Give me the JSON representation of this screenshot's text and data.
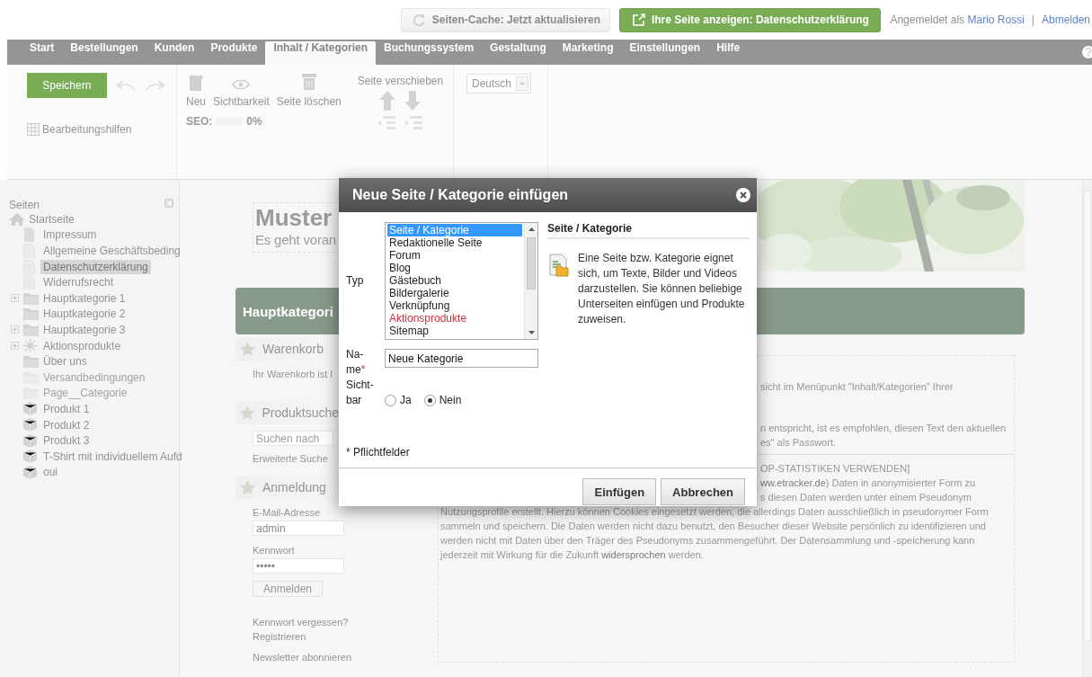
{
  "top_bar": {
    "cache_button": "Seiten-Cache: Jetzt aktualisieren",
    "view_button": "Ihre Seite anzeigen: Datenschutzerklärung",
    "logged_in_label": "Angemeldet als",
    "user": "Mario Rossi",
    "separator": "|",
    "logout": "Abmelden"
  },
  "nav_tabs": [
    {
      "label": "Start",
      "selected": false
    },
    {
      "label": "Bestellungen",
      "selected": false
    },
    {
      "label": "Kunden",
      "selected": false
    },
    {
      "label": "Produkte",
      "selected": false
    },
    {
      "label": "Inhalt / Kategorien",
      "selected": true
    },
    {
      "label": "Buchungssystem",
      "selected": false
    },
    {
      "label": "Gestaltung",
      "selected": false
    },
    {
      "label": "Marketing",
      "selected": false
    },
    {
      "label": "Einstellungen",
      "selected": false
    },
    {
      "label": "Hilfe",
      "selected": false
    }
  ],
  "ribbon": {
    "save": "Speichern",
    "editing_aids": "Bearbeitungshilfen",
    "actions": [
      {
        "label": "Neu",
        "kind": "new"
      },
      {
        "label": "Sichtbarkeit",
        "kind": "visibility"
      },
      {
        "label": "Seite löschen",
        "kind": "delete"
      }
    ],
    "seo_label": "SEO:",
    "seo": {
      "level": 0
    },
    "seo_reading": "0%",
    "move_label": "Seite verschieben",
    "language": "Deutsch"
  },
  "sidebar": {
    "title": "Seiten",
    "tree": [
      {
        "label": "Startseite",
        "kind": "home",
        "selected": false,
        "collapsed": false,
        "children": [
          {
            "label": "Impressum",
            "kind": "page",
            "selected": false,
            "collapsed": false
          },
          {
            "label": "Allgemeine Geschäftsbeding",
            "kind": "legal",
            "selected": false,
            "collapsed": false
          },
          {
            "label": "Datenschutzerklärung",
            "kind": "legal",
            "selected": true,
            "collapsed": false
          },
          {
            "label": "Widerrufsrecht",
            "kind": "legal",
            "selected": false,
            "collapsed": false
          },
          {
            "label": "Hauptkategorie 1",
            "kind": "folder",
            "selected": false,
            "collapsed": true
          },
          {
            "label": "Hauptkategorie 2",
            "kind": "folder",
            "selected": false,
            "collapsed": false
          },
          {
            "label": "Hauptkategorie 3",
            "kind": "folder",
            "selected": false,
            "collapsed": true
          },
          {
            "label": "Aktionsprodukte",
            "kind": "promo",
            "selected": false,
            "collapsed": true
          },
          {
            "label": "Über uns",
            "kind": "folder",
            "selected": false,
            "collapsed": false
          },
          {
            "label": "Versandbedingungen",
            "kind": "folder-hidden",
            "selected": false,
            "collapsed": false
          },
          {
            "label": "Page__Categorie",
            "kind": "folder-hidden",
            "selected": false,
            "collapsed": false
          },
          {
            "label": "Produkt 1",
            "kind": "product",
            "selected": false,
            "collapsed": false
          },
          {
            "label": "Produkt 2",
            "kind": "product",
            "selected": false,
            "collapsed": false
          },
          {
            "label": "Produkt 3",
            "kind": "product",
            "selected": false,
            "collapsed": false
          },
          {
            "label": "T-Shirt mit individuellem Aufd",
            "kind": "product",
            "selected": false,
            "collapsed": false
          },
          {
            "label": "oui",
            "kind": "product",
            "selected": false,
            "collapsed": false
          }
        ]
      }
    ]
  },
  "preview": {
    "logo": "Muster",
    "slogan": "Es geht voran",
    "heading": "Hauptkategori",
    "cart": {
      "title": "Warenkorb",
      "text": "Ihr Warenkorb ist l"
    },
    "search": {
      "title": "Produktsuche",
      "placeholder": "Suchen nach",
      "advanced": "Erweiterte Suche"
    },
    "login": {
      "title": "Anmeldung",
      "email_label": "E-Mail-Adresse",
      "email": "admin",
      "password_label": "Kennwort",
      "password": "•••••",
      "button": "Anmelden",
      "forgot": "Kennwort vergessen?",
      "register": "Registrieren",
      "newsletter": "Newsletter abonnieren"
    },
    "notice_lines": [
      {
        "text": "sicht im Menüpunkt \"Inhalt/Kategorien\" Ihrer"
      },
      {
        "text": "n entspricht, ist es empfohlen, diesen Text den aktuellen"
      },
      {
        "text": "es\" als Passwort."
      }
    ],
    "privacy_lines": [
      {
        "text": "OP-STATISTIKEN VERWENDEN]",
        "partial": true
      },
      {
        "link": "ww.etracker.de",
        "after": ") Daten in anonymisierter Form zu",
        "partial": true
      },
      {
        "text": "s diesen Daten werden unter einem Pseudonym",
        "partial": true
      },
      {
        "text": "Nutzungsprofile erstellt. Hierzu können Cookies eingesetzt werden, die allerdings Daten ausschließlich in pseudonymer Form",
        "partial": false
      },
      {
        "text": "sammeln und speichern. Die Daten werden nicht dazu benutzt, den Besucher dieser Website persönlich zu identifizieren und",
        "partial": false
      },
      {
        "text": "werden nicht mit Daten über den Träger des Pseudonyms zusammengeführt. Der Datensammlung und -speicherung kann",
        "partial": false
      },
      {
        "text": "jederzeit mit Wirkung für die Zukunft ",
        "link": "widersprochen",
        "after": " werden.",
        "partial": false
      }
    ]
  },
  "dialog": {
    "title": "Neue Seite / Kategorie einfügen",
    "type_label": "Typ",
    "types": [
      {
        "label": "Seite / Kategorie",
        "kind": "standard",
        "selected": true
      },
      {
        "label": "Redaktionelle Seite",
        "kind": "standard",
        "selected": false
      },
      {
        "label": "Forum",
        "kind": "standard",
        "selected": false
      },
      {
        "label": "Blog",
        "kind": "standard",
        "selected": false
      },
      {
        "label": "Gästebuch",
        "kind": "standard",
        "selected": false
      },
      {
        "label": "Bildergalerie",
        "kind": "standard",
        "selected": false
      },
      {
        "label": "Verknüpfung",
        "kind": "standard",
        "selected": false
      },
      {
        "label": "Aktionsprodukte",
        "kind": "promo",
        "selected": false
      },
      {
        "label": "Sitemap",
        "kind": "standard",
        "selected": false
      }
    ],
    "description_title": "Seite / Kategorie",
    "description": "Eine Seite bzw. Kategorie eignet sich, um Texte, Bilder und Videos darzustellen. Sie können beliebige Unterseiten einfügen und Produkte zuweisen.",
    "name_label": "Na-me",
    "required_mark": "*",
    "name_value": "Neue Kategorie",
    "visible_label": "Sicht-bar",
    "visible_options": [
      {
        "label": "Ja",
        "selected": false
      },
      {
        "label": "Nein",
        "selected": true
      }
    ],
    "required_note": "* Pflichtfelder",
    "buttons": [
      {
        "label": "Einfügen"
      },
      {
        "label": "Abbrechen"
      }
    ]
  }
}
